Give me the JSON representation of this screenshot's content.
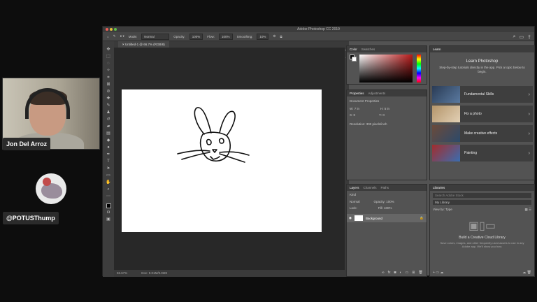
{
  "overlay": {
    "host_name": "Jon Del Arroz",
    "guest_name": "@POTUSThump"
  },
  "window": {
    "title": "Adobe Photoshop CC 2019",
    "traffic_colors": [
      "#ec5f57",
      "#e5bf3a",
      "#5fc04b"
    ]
  },
  "options_bar": {
    "mode_label": "Mode:",
    "mode_value": "Normal",
    "opacity_label": "Opacity:",
    "opacity_value": "100%",
    "flow_label": "Flow:",
    "flow_value": "100%",
    "smoothing_label": "Smoothing:",
    "smoothing_value": "10%"
  },
  "document": {
    "tab_label": "Untitled-1 @ 66.7% (RGB/8)",
    "zoom": "66.67%",
    "doc_size": "Doc: 9.01M/9.03M"
  },
  "color_panel": {
    "tabs": [
      "Color",
      "Swatches"
    ],
    "accent": "#b81a1a"
  },
  "properties_panel": {
    "tabs": [
      "Properties",
      "Adjustments"
    ],
    "header": "Document Properties",
    "w_label": "W:",
    "w_value": "7 in",
    "h_label": "H:",
    "h_value": "5 in",
    "x_label": "X:",
    "x_value": "0",
    "y_label": "Y:",
    "y_value": "0",
    "resolution": "Resolution: 300 pixels/inch"
  },
  "layers_panel": {
    "tabs": [
      "Layers",
      "Channels",
      "Paths"
    ],
    "kind_label": "Kind",
    "blend_label": "Normal",
    "opacity_label": "Opacity: 100%",
    "lock_label": "Lock:",
    "fill_label": "Fill: 100%",
    "layer_name": "Background"
  },
  "learn_panel": {
    "tab": "Learn",
    "title": "Learn Photoshop",
    "subtitle": "Step-by-step tutorials directly in the app. Pick a topic below to begin.",
    "items": [
      {
        "label": "Fundamental Skills",
        "color": "#2a3b55"
      },
      {
        "label": "Fix a photo",
        "color": "#b4956a"
      },
      {
        "label": "Make creative effects",
        "color": "#6b4a3a"
      },
      {
        "label": "Painting",
        "color": "#a22d2d"
      }
    ]
  },
  "libraries_panel": {
    "tab": "Libraries",
    "search_placeholder": "Search Adobe Stock",
    "library": "My Library",
    "view_by": "View by: Type",
    "cta_title": "Build a Creative Cloud Library",
    "cta_body": "Save colors, images, and other frequently used assets to use in any Adobe app. We'll show you how."
  }
}
